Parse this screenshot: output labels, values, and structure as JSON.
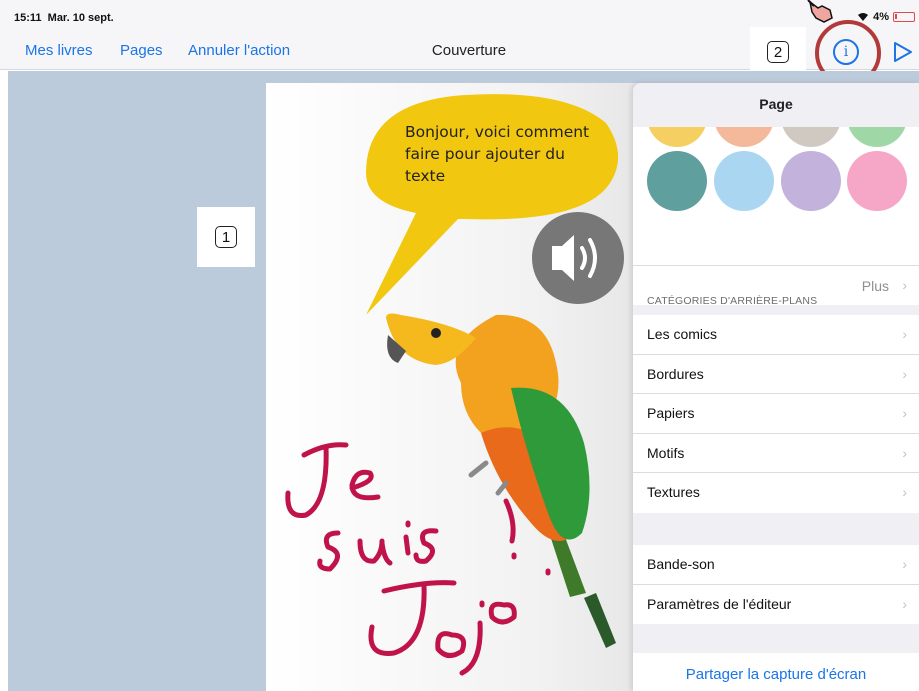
{
  "status_bar": {
    "time": "15:11",
    "date": "Mar. 10 sept.",
    "battery": "4%"
  },
  "nav": {
    "back_label": "Mes livres",
    "pages_label": "Pages",
    "undo_label": "Annuler l'action",
    "title": "Couverture",
    "info_icon": "info-icon",
    "play_icon": "play-icon"
  },
  "annotations": {
    "step1": "1",
    "step2": "2"
  },
  "page": {
    "bubble_text": "Bonjour, voici comment faire pour ajouter du texte",
    "handwriting": "Je suis Jojo !",
    "sound_icon": "speaker-icon"
  },
  "panel": {
    "title": "Page",
    "colors": [
      "#f6cf63",
      "#f4b99a",
      "#cfc9c1",
      "#9fd8a6",
      "#5f9f9e",
      "#aad6f1",
      "#c3b2dc",
      "#f6a6c7"
    ],
    "more_label": "Plus",
    "section_title": "CATÉGORIES D'ARRIÈRE-PLANS",
    "categories": [
      "Les comics",
      "Bordures",
      "Papiers",
      "Motifs",
      "Textures"
    ],
    "other_items": [
      "Bande-son",
      "Paramètres de l'éditeur"
    ],
    "share_label": "Partager la capture d'écran"
  }
}
